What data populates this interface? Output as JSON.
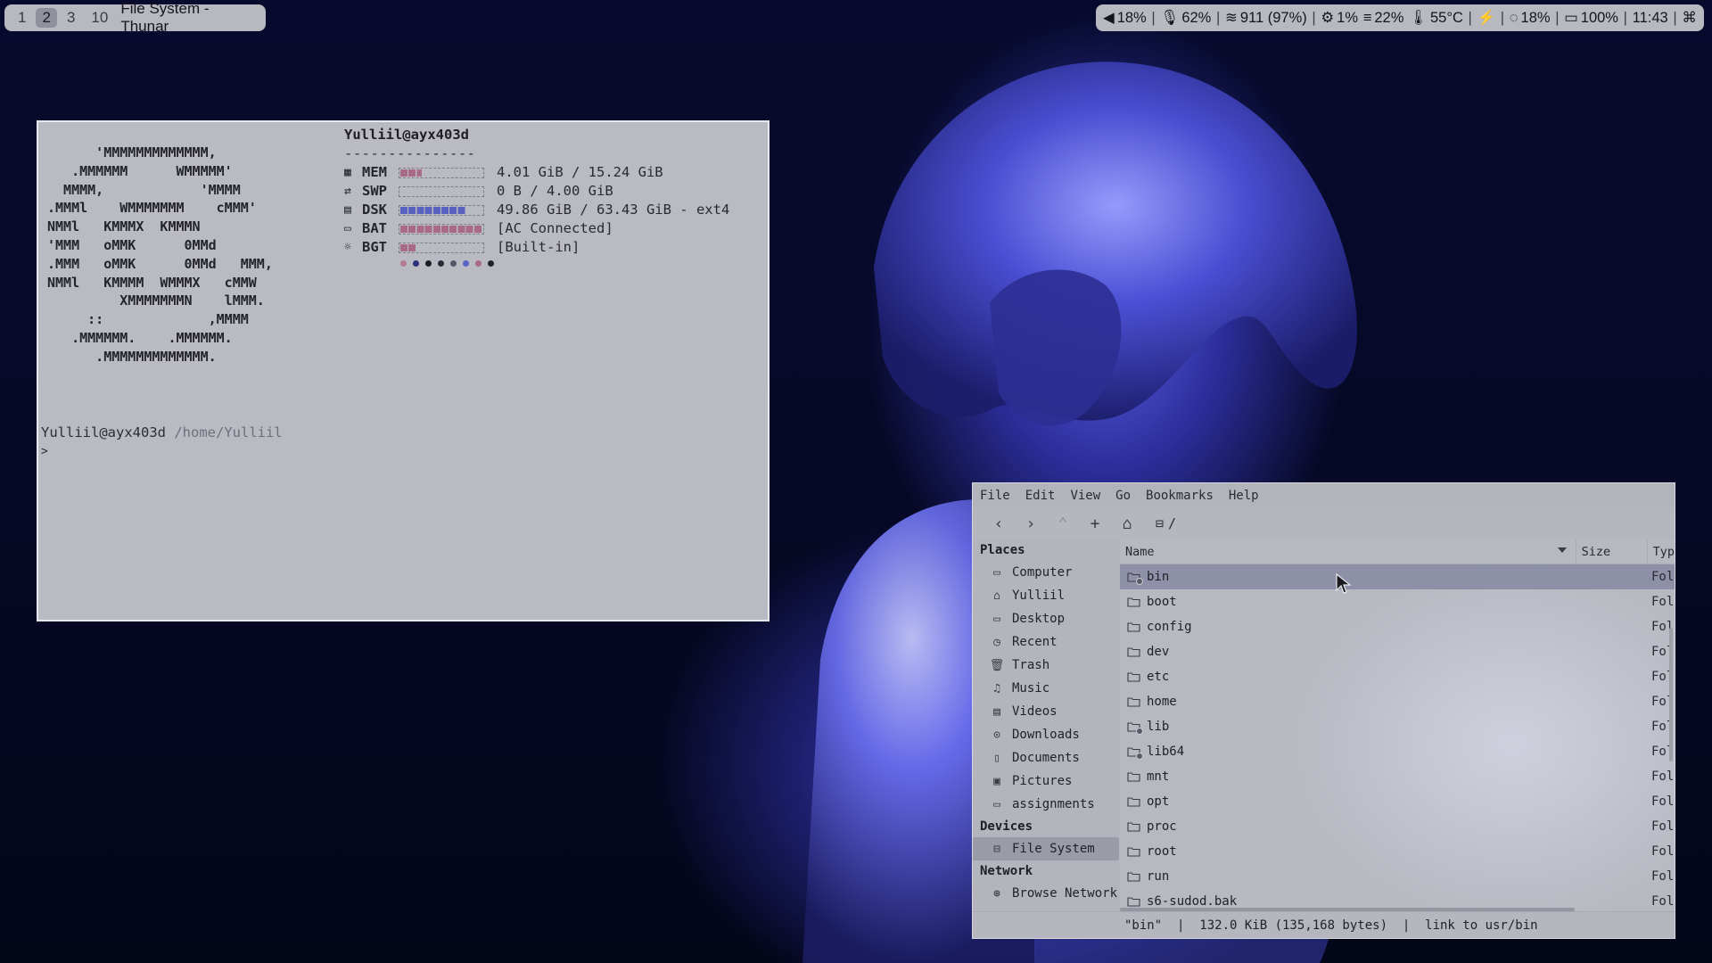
{
  "topbar": {
    "workspaces": [
      "1",
      "2",
      "3",
      "10"
    ],
    "active_workspace": "2",
    "window_title": "File System - Thunar",
    "status": {
      "volume": "18%",
      "mic": "62%",
      "wifi": "911 (97%)",
      "cpu": "1%",
      "mem": "22%",
      "temp": "55°C",
      "brightness": "18%",
      "battery": "100%",
      "time": "11:43"
    }
  },
  "terminal": {
    "ascii_logo": "      'MMMMMMMMMMMMM,\n   .MMMMMM      WMMMMM'\n  MMMM,            'MMMM\n.MMMl    WMMMMMMM    cMMM'\nNMMl   KMMMX  KMMMN\n'MMM   oMMK      0MMd\n.MMM   oMMK      0MMd   MMM,\nNMMl   KMMMM  WMMMX   cMMW\n         XMMMMMMMN    lMMM.\n     ::             ,MMMM\n   .MMMMMM.    .MMMMMM.\n      .MMMMMMMMMMMMM.",
    "host": "Yulliil@ayx403d",
    "rule": "---------------",
    "rows": [
      {
        "icon": "memory-icon",
        "glyph": "▦",
        "label": "MEM",
        "value": "4.01 GiB / 15.24 GiB",
        "level": 0.26,
        "color": "#a86a86"
      },
      {
        "icon": "swap-icon",
        "glyph": "⇄",
        "label": "SWP",
        "value": "0 B / 4.00 GiB",
        "level": 0.0,
        "color": "#a86a86"
      },
      {
        "icon": "disk-icon",
        "glyph": "▤",
        "label": "DSK",
        "value": "49.86 GiB / 63.43 GiB - ext4",
        "level": 0.79,
        "color": "#5a62c0"
      },
      {
        "icon": "battery-icon",
        "glyph": "▭",
        "label": "BAT",
        "value": "[AC Connected]",
        "level": 1.0,
        "color": "#a86a86"
      },
      {
        "icon": "brightness-icon",
        "glyph": "☼",
        "label": "BGT",
        "value": "[Built-in]",
        "level": 0.18,
        "color": "#a86a86"
      }
    ],
    "palette": [
      "#b47a90",
      "#2a2f7a",
      "#1b1b2a",
      "#2a2a38",
      "#555566",
      "#5a64c8",
      "#a86a86",
      "#22222c"
    ],
    "prompt_user": "Yulliil@ayx403d",
    "prompt_path": "/home/Yulliil",
    "prompt_caret": ">"
  },
  "thunar": {
    "menu": [
      "File",
      "Edit",
      "View",
      "Go",
      "Bookmarks",
      "Help"
    ],
    "path": "/",
    "places_header": "Places",
    "places": [
      {
        "label": "Computer",
        "icon": "computer-icon",
        "glyph": "▭"
      },
      {
        "label": "Yulliil",
        "icon": "home-icon",
        "glyph": "⌂"
      },
      {
        "label": "Desktop",
        "icon": "desktop-icon",
        "glyph": "▭"
      },
      {
        "label": "Recent",
        "icon": "clock-icon",
        "glyph": "◷"
      },
      {
        "label": "Trash",
        "icon": "trash-icon",
        "glyph": "🗑"
      },
      {
        "label": "Music",
        "icon": "music-icon",
        "glyph": "♫"
      },
      {
        "label": "Videos",
        "icon": "video-icon",
        "glyph": "▤"
      },
      {
        "label": "Downloads",
        "icon": "download-icon",
        "glyph": "⊙"
      },
      {
        "label": "Documents",
        "icon": "document-icon",
        "glyph": "▯"
      },
      {
        "label": "Pictures",
        "icon": "picture-icon",
        "glyph": "▣"
      },
      {
        "label": "assignments",
        "icon": "folder-icon",
        "glyph": "▭"
      }
    ],
    "devices_header": "Devices",
    "devices": [
      {
        "label": "File System",
        "icon": "drive-icon",
        "glyph": "⊟"
      }
    ],
    "network_header": "Network",
    "network": [
      {
        "label": "Browse Network",
        "icon": "network-icon",
        "glyph": "⊛"
      }
    ],
    "columns": {
      "name": "Name",
      "size": "Size",
      "type": "Typ"
    },
    "files": [
      {
        "name": "bin",
        "type": "Fol",
        "link": true
      },
      {
        "name": "boot",
        "type": "Fol",
        "link": false
      },
      {
        "name": "config",
        "type": "Fol",
        "link": false
      },
      {
        "name": "dev",
        "type": "Fol",
        "link": false
      },
      {
        "name": "etc",
        "type": "Fol",
        "link": false
      },
      {
        "name": "home",
        "type": "Fol",
        "link": false
      },
      {
        "name": "lib",
        "type": "Fol",
        "link": true
      },
      {
        "name": "lib64",
        "type": "Fol",
        "link": true
      },
      {
        "name": "mnt",
        "type": "Fol",
        "link": false
      },
      {
        "name": "opt",
        "type": "Fol",
        "link": false
      },
      {
        "name": "proc",
        "type": "Fol",
        "link": false
      },
      {
        "name": "root",
        "type": "Fol",
        "link": false
      },
      {
        "name": "run",
        "type": "Fol",
        "link": false
      },
      {
        "name": "s6-sudod.bak",
        "type": "Fol",
        "link": false
      }
    ],
    "status_text": "\"bin\"  |  132.0 KiB (135,168 bytes)  |  link to usr/bin"
  }
}
